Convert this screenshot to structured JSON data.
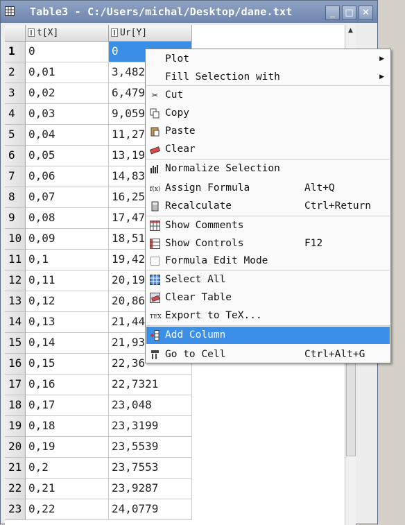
{
  "window": {
    "title": "Table3 - C:/Users/michal/Desktop/dane.txt",
    "buttons": {
      "minimize": "_",
      "maximize": "□",
      "close": "✕"
    }
  },
  "table": {
    "columns": [
      "t[X]",
      "Ur[Y]"
    ],
    "rows": [
      {
        "n": "1",
        "x": "0",
        "y": "0"
      },
      {
        "n": "2",
        "x": "0,01",
        "y": "3,482"
      },
      {
        "n": "3",
        "x": "0,02",
        "y": "6,479"
      },
      {
        "n": "4",
        "x": "0,03",
        "y": "9,059"
      },
      {
        "n": "5",
        "x": "0,04",
        "y": "11,27"
      },
      {
        "n": "6",
        "x": "0,05",
        "y": "13,19"
      },
      {
        "n": "7",
        "x": "0,06",
        "y": "14,83"
      },
      {
        "n": "8",
        "x": "0,07",
        "y": "16,25"
      },
      {
        "n": "9",
        "x": "0,08",
        "y": "17,47"
      },
      {
        "n": "10",
        "x": "0,09",
        "y": "18,51"
      },
      {
        "n": "11",
        "x": "0,1",
        "y": "19,42"
      },
      {
        "n": "12",
        "x": "0,11",
        "y": "20,19"
      },
      {
        "n": "13",
        "x": "0,12",
        "y": "20,86"
      },
      {
        "n": "14",
        "x": "0,13",
        "y": "21,44"
      },
      {
        "n": "15",
        "x": "0,14",
        "y": "21,93"
      },
      {
        "n": "16",
        "x": "0,15",
        "y": "22,36"
      },
      {
        "n": "17",
        "x": "0,16",
        "y": "22,7321"
      },
      {
        "n": "18",
        "x": "0,17",
        "y": "23,048"
      },
      {
        "n": "19",
        "x": "0,18",
        "y": "23,3199"
      },
      {
        "n": "20",
        "x": "0,19",
        "y": "23,5539"
      },
      {
        "n": "21",
        "x": "0,2",
        "y": "23,7553"
      },
      {
        "n": "22",
        "x": "0,21",
        "y": "23,9287"
      },
      {
        "n": "23",
        "x": "0,22",
        "y": "24,0779"
      }
    ]
  },
  "context_menu": {
    "items": [
      {
        "label": "Plot",
        "shortcut": "",
        "submenu": true,
        "icon": "none"
      },
      {
        "label": "Fill Selection with",
        "shortcut": "",
        "submenu": true,
        "icon": "none"
      },
      {
        "label": "Cut",
        "shortcut": "",
        "icon": "scissors-icon"
      },
      {
        "label": "Copy",
        "shortcut": "",
        "icon": "copy-icon"
      },
      {
        "label": "Paste",
        "shortcut": "",
        "icon": "paste-icon"
      },
      {
        "label": "Clear",
        "shortcut": "",
        "icon": "eraser-icon"
      },
      {
        "label": "Normalize Selection",
        "shortcut": "",
        "icon": "normalize-icon"
      },
      {
        "label": "Assign Formula",
        "shortcut": "Alt+Q",
        "icon": "formula-icon"
      },
      {
        "label": "Recalculate",
        "shortcut": "Ctrl+Return",
        "icon": "calculator-icon"
      },
      {
        "label": "Show Comments",
        "shortcut": "",
        "icon": "comments-table-icon"
      },
      {
        "label": "Show Controls",
        "shortcut": "F12",
        "icon": "controls-table-icon"
      },
      {
        "label": "Formula Edit Mode",
        "shortcut": "",
        "icon": "checkbox-icon"
      },
      {
        "label": "Select All",
        "shortcut": "",
        "icon": "select-all-icon"
      },
      {
        "label": "Clear Table",
        "shortcut": "",
        "icon": "clear-table-icon"
      },
      {
        "label": "Export to TeX...",
        "shortcut": "",
        "icon": "tex-icon"
      },
      {
        "label": "Add Column",
        "shortcut": "",
        "icon": "add-column-icon",
        "highlighted": true
      },
      {
        "label": "Go to Cell",
        "shortcut": "Ctrl+Alt+G",
        "icon": "goto-cell-icon"
      }
    ],
    "highlight_color": "#3b8fe8"
  },
  "colors": {
    "selection": "#3a8ee6",
    "titlebar": "#7d93b9"
  }
}
